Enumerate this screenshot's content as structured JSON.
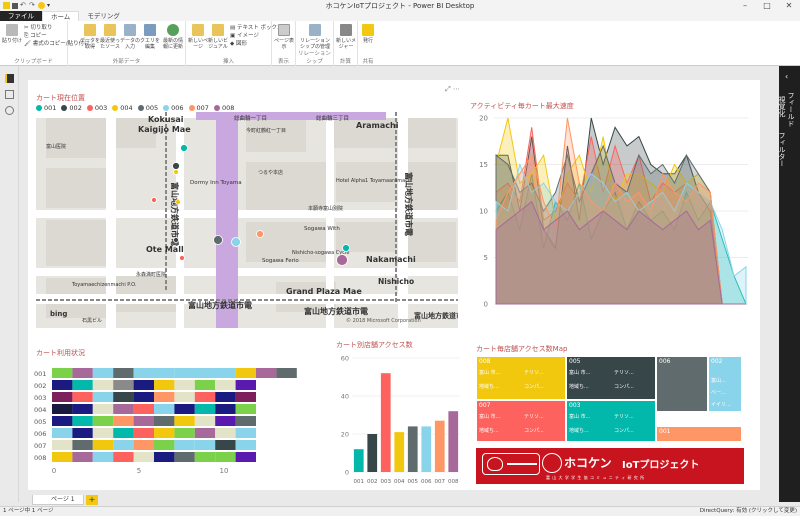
{
  "window": {
    "title": "ホコケンIoTプロジェクト - Power BI Desktop"
  },
  "menu_tabs": [
    {
      "label": "ファイル"
    },
    {
      "label": "ホーム"
    },
    {
      "label": "モデリング"
    }
  ],
  "ribbon": {
    "clipboard": {
      "paste": "貼り付け",
      "cut": "切り取り",
      "copy": "コピー",
      "format_painter": "書式のコピー/貼り付け",
      "group": "クリップボード"
    },
    "external_data": {
      "get_data": "データを取得",
      "recent_sources": "最近使ったソース",
      "enter_data": "データの入力",
      "edit_queries": "クエリを編集",
      "refresh": "最新の情報に更新",
      "group": "外部データ"
    },
    "insert": {
      "new_page": "新しいページ",
      "new_visual": "新しいビジュアル",
      "text_box": "テキスト ボックス",
      "image": "イメージ",
      "shapes": "図形",
      "group": "挿入"
    },
    "view": {
      "page_view": "ページ表示",
      "group": "表示"
    },
    "relationships": {
      "manage": "リレーションシップの管理",
      "group": "リレーションシップ"
    },
    "calculations": {
      "new_measure": "新しいメジャー",
      "group": "計算"
    },
    "share": {
      "publish": "発行",
      "group": "共有"
    }
  },
  "right_pane": {
    "fields": "フィールド",
    "visualizations": "視覚化",
    "filters": "フィルター"
  },
  "map_visual": {
    "title": "カート現在位置",
    "legend": [
      {
        "label": "001",
        "color": "#01b8aa"
      },
      {
        "label": "002",
        "color": "#374649"
      },
      {
        "label": "003",
        "color": "#fd625e"
      },
      {
        "label": "004",
        "color": "#f2c80f"
      },
      {
        "label": "005",
        "color": "#5f6b6d"
      },
      {
        "label": "006",
        "color": "#8ad4eb"
      },
      {
        "label": "007",
        "color": "#fe9666"
      },
      {
        "label": "008",
        "color": "#a66999"
      }
    ],
    "labels": {
      "kokusai": "Kokusai",
      "kaigijo": "Kaigijo Mae",
      "aramachi": "Aramachi",
      "ote_mall": "Ote Mall",
      "nakamachi": "Nakamachi",
      "nishicho": "Nishicho",
      "grand_plaza": "Grand Plaza Mae",
      "dormy": "Dormy Inn Toyama",
      "hotel_alpha": "Hotel Alpha1 Toyamaaramachi",
      "sogawa_with": "Sogawa With",
      "sogawa_ferio": "Sogawa Ferio",
      "nishicho_sogawa": "Nishicho-sogawa Cycle",
      "toyamaechizen": "Toyamaechizenmachi P.O.",
      "rail1": "富山地方鉄道市電",
      "rail2": "富山地方鉄道市電",
      "rail3": "富山地方鉄道市電",
      "chome1": "総曲輪一丁目",
      "chome2": "総曲輪二丁目",
      "chome3": "総曲輪三丁目",
      "imaizumi": "今町紅鶴紅一丁目",
      "hospital": "富山医院",
      "tsuruya": "つるや本店",
      "honkan": "本願寺富山別院",
      "sakuragi": "荒町一丁目",
      "bing": "bing",
      "copyright": "© 2018 Microsoft Corporation",
      "nagaimachi": "永森満町医院",
      "ishiya": "石黒ビル"
    }
  },
  "area_visual": {
    "title": "アクティビティ毎カート最大速度"
  },
  "chart_data": [
    {
      "type": "area",
      "title": "アクティビティ毎カート最大速度",
      "ylim": [
        0,
        20
      ],
      "yticks": [
        "0",
        "5",
        "10",
        "15",
        "20"
      ],
      "x": [
        0,
        1,
        2,
        3,
        4,
        5,
        6,
        7,
        8,
        9,
        10,
        11,
        12,
        13,
        14,
        15,
        16,
        17,
        18,
        19,
        20,
        21
      ],
      "series": [
        {
          "color": "#01b8aa",
          "values": [
            10,
            12,
            8,
            14,
            6,
            11,
            9,
            13,
            7,
            10,
            12,
            8,
            11,
            9,
            10,
            8,
            12,
            9,
            11,
            7,
            3,
            0
          ]
        },
        {
          "color": "#374649",
          "values": [
            16,
            16,
            10,
            18,
            8,
            6,
            17,
            9,
            20,
            15,
            19,
            17,
            18,
            15,
            14,
            14,
            16,
            12,
            10,
            0,
            0,
            0
          ]
        },
        {
          "color": "#fd625e",
          "values": [
            12,
            13,
            11,
            19,
            9,
            10,
            13,
            11,
            18,
            12,
            17,
            13,
            16,
            11,
            13,
            12,
            13,
            12,
            11,
            0,
            0,
            0
          ]
        },
        {
          "color": "#f2c80f",
          "values": [
            15,
            20,
            13,
            14,
            16,
            9,
            14,
            16,
            12,
            18,
            11,
            14,
            14,
            13,
            12,
            15,
            13,
            14,
            12,
            0,
            0,
            0
          ]
        },
        {
          "color": "#5f6b6d",
          "values": [
            16,
            15,
            12,
            13,
            10,
            12,
            16,
            11,
            14,
            17,
            13,
            12,
            16,
            14,
            15,
            13,
            16,
            14,
            12,
            0,
            0,
            0
          ]
        },
        {
          "color": "#8ad4eb",
          "values": [
            11,
            10,
            15,
            12,
            13,
            11,
            10,
            12,
            14,
            13,
            11,
            12,
            10,
            11,
            12,
            10,
            13,
            12,
            11,
            8,
            3,
            4
          ]
        },
        {
          "color": "#fe9666",
          "values": [
            9,
            12,
            14,
            16,
            11,
            8,
            20,
            13,
            11,
            10,
            13,
            11,
            12,
            10,
            14,
            12,
            11,
            13,
            12,
            0,
            0,
            0
          ]
        },
        {
          "color": "#a66999",
          "values": [
            8,
            9,
            10,
            11,
            8,
            9,
            10,
            8,
            9,
            10,
            9,
            8,
            10,
            9,
            8,
            9,
            10,
            8,
            9,
            0,
            0,
            0
          ]
        }
      ]
    },
    {
      "type": "table",
      "title": "カート利用状況",
      "rows": [
        "001",
        "002",
        "003",
        "004",
        "005",
        "006",
        "007",
        "008"
      ],
      "xticks": [
        "0",
        "5",
        "10"
      ],
      "xlim": [
        0,
        14
      ],
      "cells": [
        [
          "#7bd14a",
          "#a66999",
          "#8ad4eb",
          "#5f6b6d",
          "#8ad4eb",
          "#8ad4eb",
          "#8ad4eb",
          "#f2c80f",
          "#a66999",
          "#5f6b6d"
        ],
        [
          "#1a1a80",
          "#01b8aa",
          "#e3e3c8",
          "#8a8a8a",
          "#1a1a80",
          "#f2c80f",
          "#e3e3c8",
          "#7bd14a",
          "#e3e3c8",
          "#5a1ab0"
        ],
        [
          "#7d1f5a",
          "#fd625e",
          "#8ad4eb",
          "#374649",
          "#1a1a80",
          "#fe9666",
          "#e3e3c8",
          "#fd625e",
          "#1a1a80",
          "#7d1f5a"
        ],
        [
          "#1a1a40",
          "#1a1a80",
          "#e3e3c8",
          "#a66999",
          "#fd625e",
          "#8ad4eb",
          "#1a1a80",
          "#01b8aa",
          "#1a1a80",
          "#7bd14a"
        ],
        [
          "#1a1a80",
          "#01b8aa",
          "#7bd14a",
          "#fe9666",
          "#a66999",
          "#5f6b6d",
          "#f2c80f",
          "#e3e3c8",
          "#5a1ab0",
          "#5f6b6d"
        ],
        [
          "#8ad4eb",
          "#1a1a80",
          "#e3e3c8",
          "#01b8aa",
          "#fd625e",
          "#f2c80f",
          "#7bd14a",
          "#a66999",
          "#e3e3c8",
          "#8ad4eb"
        ],
        [
          "#e3e3c8",
          "#5f6b6d",
          "#f2c80f",
          "#8ad4eb",
          "#fe9666",
          "#7bd14a",
          "#8ad4eb",
          "#8ad4eb",
          "#374649",
          "#8ad4eb"
        ],
        [
          "#f2c80f",
          "#a66999",
          "#8ad4eb",
          "#fd625e",
          "#e3e3c8",
          "#1a1a80",
          "#5f6b6d",
          "#7bd14a",
          "#7bd14a",
          "#5a1ab0"
        ]
      ],
      "widths": [
        [
          1.2,
          1.2,
          1.2,
          1.2,
          1.2,
          1.2,
          3.6,
          1.2,
          1.2,
          1.2
        ],
        [
          1.2,
          1.2,
          1.2,
          1.2,
          1.2,
          1.2,
          1.2,
          1.2,
          1.2,
          1.2
        ],
        [
          1.2,
          1.2,
          1.2,
          1.2,
          1.2,
          1.2,
          1.2,
          1.2,
          1.2,
          1.2
        ],
        [
          1.2,
          1.2,
          1.2,
          1.2,
          1.2,
          1.2,
          1.2,
          1.2,
          1.2,
          1.2
        ],
        [
          1.2,
          1.2,
          1.2,
          1.2,
          1.2,
          1.2,
          1.2,
          1.2,
          1.2,
          1.2
        ],
        [
          1.2,
          1.2,
          1.2,
          1.2,
          1.2,
          1.2,
          1.2,
          1.2,
          1.2,
          1.2
        ],
        [
          1.2,
          1.2,
          1.2,
          1.2,
          1.2,
          1.2,
          1.2,
          1.2,
          1.2,
          1.2
        ],
        [
          1.2,
          1.2,
          1.2,
          1.2,
          1.2,
          1.2,
          1.2,
          1.2,
          1.2,
          1.2
        ]
      ]
    },
    {
      "type": "bar",
      "title": "カート別店舗アクセス数",
      "categories": [
        "001",
        "002",
        "003",
        "004",
        "005",
        "006",
        "007",
        "008"
      ],
      "values": [
        12,
        20,
        52,
        21,
        24,
        24,
        27,
        32
      ],
      "colors": [
        "#01b8aa",
        "#374649",
        "#fd625e",
        "#f2c80f",
        "#5f6b6d",
        "#8ad4eb",
        "#fe9666",
        "#a66999"
      ],
      "ylim": [
        0,
        60
      ],
      "yticks": [
        "0",
        "20",
        "40",
        "60"
      ]
    }
  ],
  "treemap": {
    "title": "カート毎店舗アクセス数Map",
    "tiles": [
      {
        "label": "008",
        "color": "#f2c80f",
        "sub": [
          "富山 市...",
          "テリソ...",
          "地域ち...",
          "コンパ..."
        ]
      },
      {
        "label": "005",
        "color": "#374649",
        "sub": [
          "富山 市...",
          "テリソ...",
          "地域ち...",
          "コンパ..."
        ]
      },
      {
        "label": "006",
        "color": "#5f6b6d",
        "sub": []
      },
      {
        "label": "002",
        "color": "#8ad4eb",
        "sub": [
          "富山...",
          "ベー...",
          "イイリ..."
        ]
      },
      {
        "label": "007",
        "color": "#fd625e",
        "sub": [
          "富山 市...",
          "テリソ...",
          "地域ち...",
          "コンパ..."
        ]
      },
      {
        "label": "003",
        "color": "#01b8aa",
        "sub": [
          "富山 市...",
          "テリソ...",
          "地域ち...",
          "コンパ..."
        ]
      },
      {
        "label": "001",
        "color": "#fe9666",
        "sub": []
      }
    ]
  },
  "banner": {
    "logo_text": "ホコケン",
    "title": "IoTプロジェクト",
    "subtitle": "富 山 大 学 学 生 協 コ ミ ュ ニ テ ィ 研 究 所"
  },
  "pages": {
    "tab": "ページ 1",
    "add": "+"
  },
  "status": {
    "left": "1 ページ中 1 ページ",
    "right": "DirectQuery: 有効 (クリックして変更)"
  }
}
